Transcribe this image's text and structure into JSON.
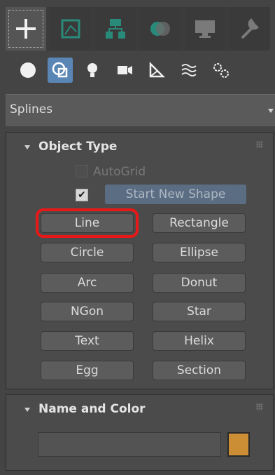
{
  "dropdown": {
    "label": "Splines"
  },
  "object_type": {
    "title": "Object Type",
    "autogrid_label": "AutoGrid",
    "start_new_shape_label": "Start New Shape",
    "buttons": [
      [
        "Line",
        "Rectangle"
      ],
      [
        "Circle",
        "Ellipse"
      ],
      [
        "Arc",
        "Donut"
      ],
      [
        "NGon",
        "Star"
      ],
      [
        "Text",
        "Helix"
      ],
      [
        "Egg",
        "Section"
      ]
    ]
  },
  "name_color": {
    "title": "Name and Color",
    "name_value": "",
    "color": "#cc8e35"
  },
  "colors": {
    "accent": "#5a86b5",
    "highlight": "#e81818"
  },
  "icons": {
    "tabs": [
      "create-icon",
      "modify-icon",
      "hierarchy-icon",
      "motion-icon",
      "display-icon",
      "utilities-icon"
    ],
    "categories": [
      "geometry-icon",
      "shapes-icon",
      "lights-icon",
      "cameras-icon",
      "helpers-icon",
      "space-warps-icon",
      "systems-icon"
    ]
  }
}
